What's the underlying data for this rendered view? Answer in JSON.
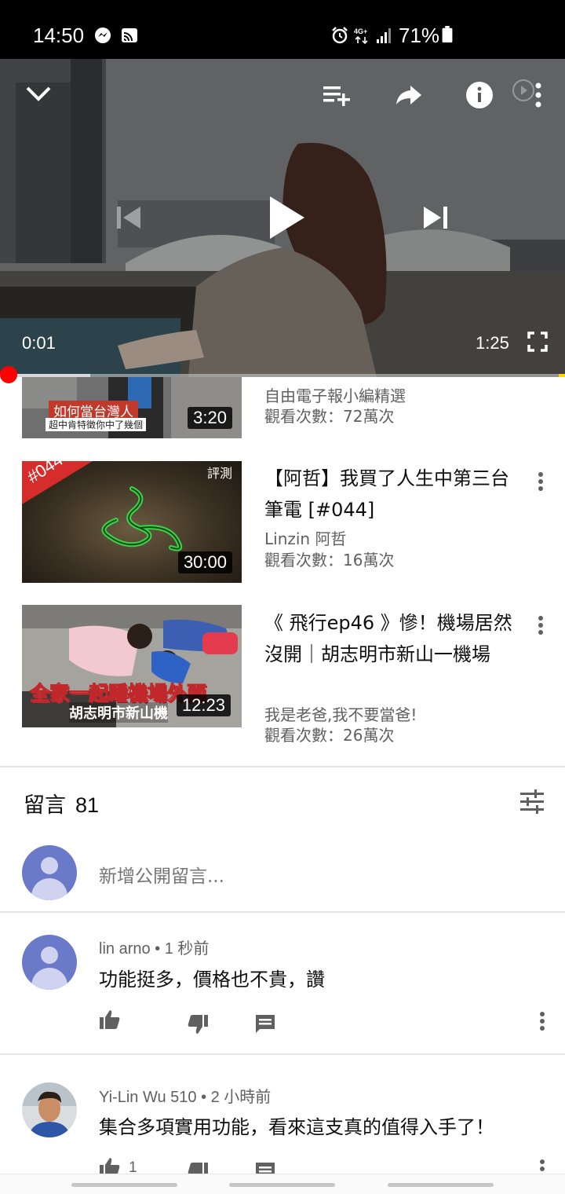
{
  "status_bar": {
    "time": "14:50",
    "battery_percent": "71%",
    "network": "4G+"
  },
  "player": {
    "current_time": "0:01",
    "duration": "1:25",
    "progress_fraction": 0.012,
    "buffered_fraction": 0.16,
    "accent_color": "#ff0000"
  },
  "related": [
    {
      "thumb_caption": "如何當台灣人",
      "thumb_subcaption": "超中肯特徵你中了幾個",
      "duration": "3:20",
      "title": "",
      "channel": "自由電子報小編精選",
      "views": "觀看次數：72萬次"
    },
    {
      "thumb_badge": "#044",
      "thumb_tag": "評測",
      "duration": "30:00",
      "title": "【阿哲】我買了人生中第三台筆電 [#044]",
      "channel": "Linzin 阿哲",
      "views": "觀看次數：16萬次"
    },
    {
      "thumb_caption": "全家一起睡機場外面",
      "thumb_subcaption": "胡志明市新山機",
      "duration": "12:23",
      "title": "《 飛行ep46 》慘！機場居然沒開｜胡志明市新山一機場",
      "channel": "我是老爸,我不要當爸!",
      "views": "觀看次數：26萬次"
    }
  ],
  "comments_section": {
    "label": "留言",
    "count": "81",
    "add_placeholder": "新增公開留言..."
  },
  "comments": [
    {
      "author_line": "lin arno • 1 秒前",
      "text": "功能挺多，價格也不貴，讚",
      "likes": ""
    },
    {
      "author_line": "Yi-Lin Wu 510 • 2 小時前",
      "text": "集合多項實用功能，看來這支真的值得入手了！",
      "likes": "1"
    }
  ],
  "icons": {
    "collapse": "chevron-down-icon",
    "add_to_playlist": "playlist-add-icon",
    "share": "share-icon",
    "info": "info-icon",
    "more": "more-vert-icon",
    "previous": "skip-previous-icon",
    "play": "play-icon",
    "next": "skip-next-icon",
    "fullscreen": "fullscreen-icon",
    "sort": "sort-icon",
    "like": "thumb-up-icon",
    "dislike": "thumb-down-icon",
    "reply": "reply-icon"
  }
}
